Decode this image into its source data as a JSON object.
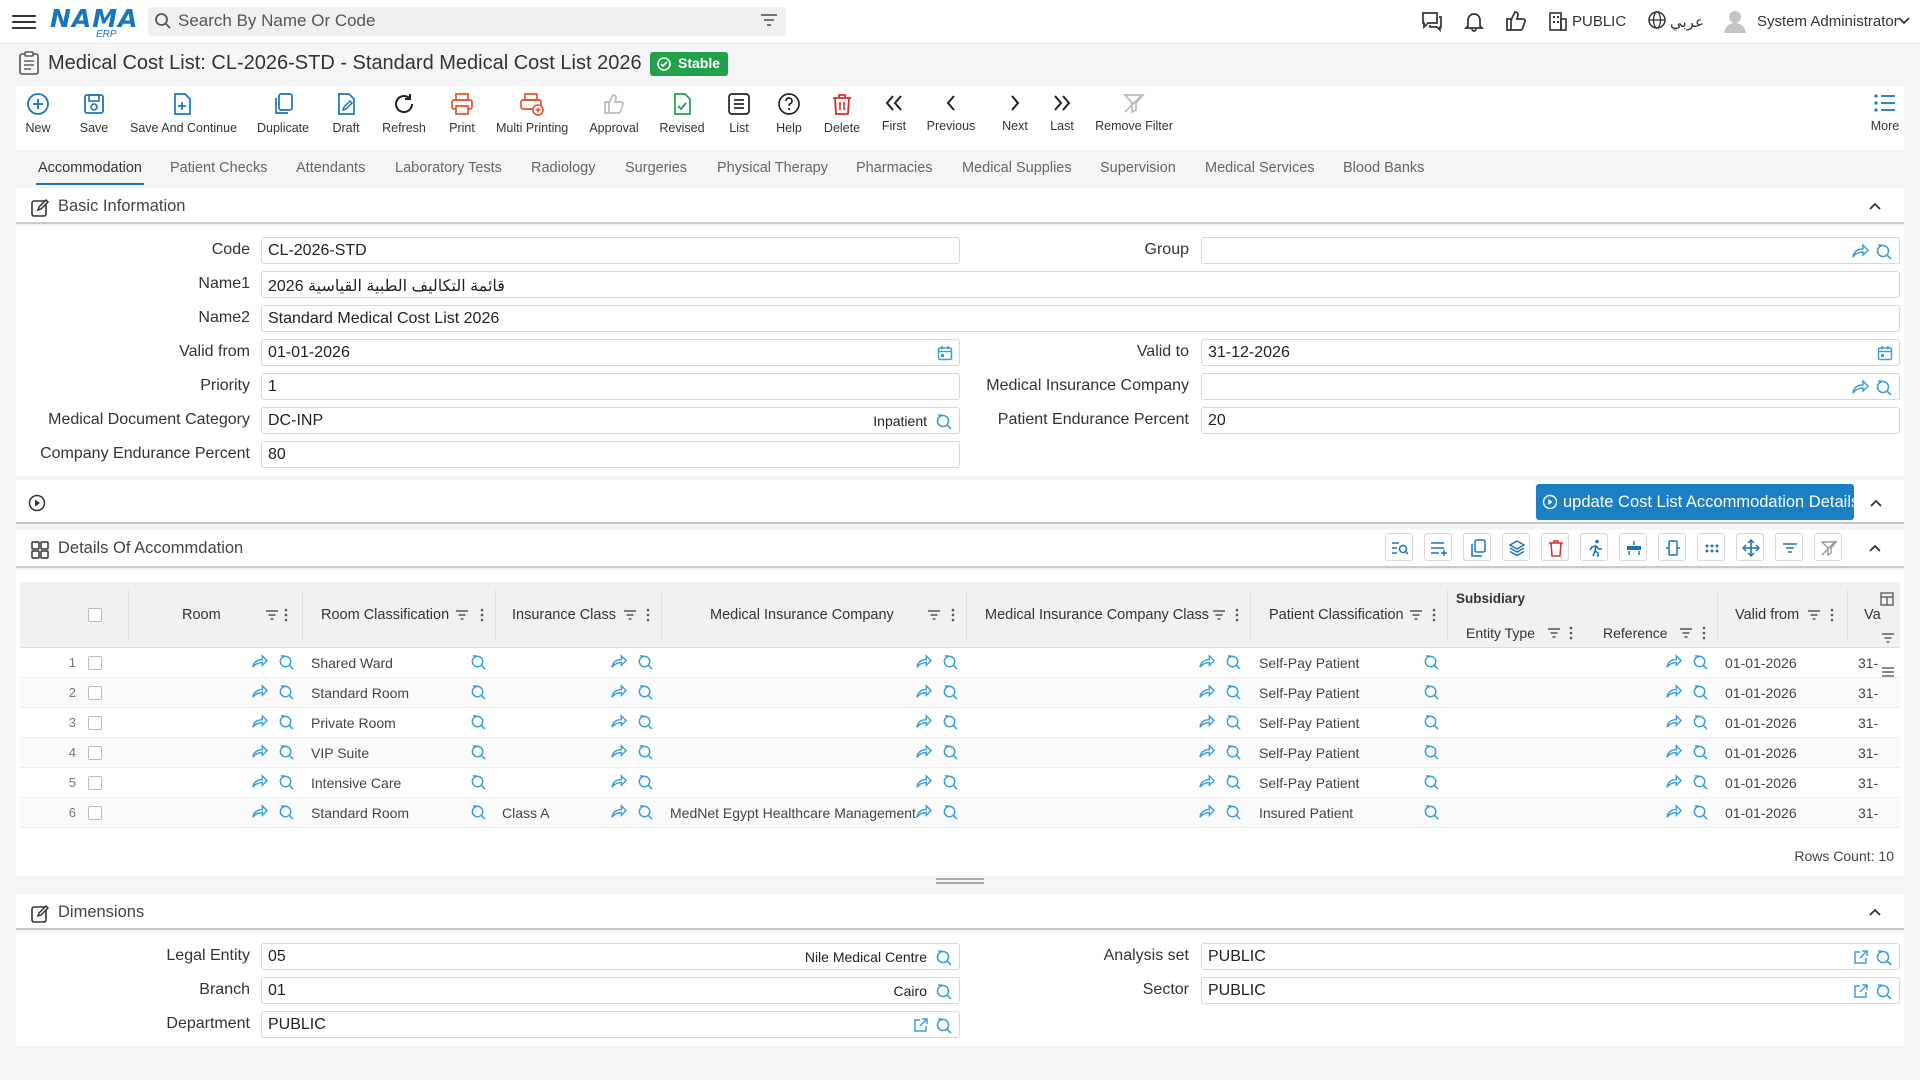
{
  "app": {
    "logo_main": "NAMA",
    "logo_sub": "ERP",
    "search_placeholder": "Search By Name Or Code",
    "public_label": "PUBLIC",
    "language_label": "عربي",
    "user_name": "System Administrator"
  },
  "page": {
    "title": "Medical Cost List: CL-2026-STD - Standard Medical Cost List 2026",
    "status_badge": "Stable"
  },
  "toolbar": {
    "new": "New",
    "save": "Save",
    "save_continue": "Save And Continue",
    "duplicate": "Duplicate",
    "draft": "Draft",
    "refresh": "Refresh",
    "print": "Print",
    "multi_printing": "Multi Printing",
    "approval": "Approval",
    "revised": "Revised",
    "list": "List",
    "help": "Help",
    "delete": "Delete",
    "first": "First",
    "previous": "Previous",
    "next": "Next",
    "last": "Last",
    "remove_filter": "Remove Filter",
    "more": "More"
  },
  "tabs": [
    "Accommodation",
    "Patient Checks",
    "Attendants",
    "Laboratory Tests",
    "Radiology",
    "Surgeries",
    "Physical Therapy",
    "Pharmacies",
    "Medical Supplies",
    "Supervision",
    "Medical Services",
    "Blood Banks"
  ],
  "basic_info": {
    "title": "Basic Information",
    "code_label": "Code",
    "code_value": "CL-2026-STD",
    "group_label": "Group",
    "group_value": "",
    "name1_label": "Name1",
    "name1_value": "قائمة التكاليف الطبية القياسية 2026",
    "name2_label": "Name2",
    "name2_value": "Standard Medical Cost List 2026",
    "valid_from_label": "Valid from",
    "valid_from_value": "01-01-2026",
    "valid_to_label": "Valid to",
    "valid_to_value": "31-12-2026",
    "priority_label": "Priority",
    "priority_value": "1",
    "insurance_company_label": "Medical Insurance Company",
    "insurance_company_value": "",
    "doc_category_label": "Medical Document Category",
    "doc_category_value": "DC-INP",
    "doc_category_desc": "Inpatient",
    "patient_endurance_label": "Patient Endurance Percent",
    "patient_endurance_value": "20",
    "company_endurance_label": "Company Endurance Percent",
    "company_endurance_value": "80"
  },
  "update_button": "update Cost List Accommodation Details",
  "details": {
    "title": "Details Of Accommdation",
    "headers": {
      "room": "Room",
      "room_classification": "Room Classification",
      "insurance_class": "Insurance Class",
      "insurance_company": "Medical Insurance Company",
      "insurance_company_class": "Medical Insurance Company Class",
      "patient_classification": "Patient Classification",
      "subsidiary": "Subsidiary",
      "entity_type": "Entity Type",
      "reference": "Reference",
      "valid_from": "Valid from",
      "valid_to_short": "Va"
    },
    "rows": [
      {
        "num": "1",
        "room_classification": "Shared Ward",
        "insurance_class": "",
        "insurance_company": "",
        "patient_classification": "Self-Pay Patient",
        "valid_from": "01-01-2026",
        "valid_to": "31-"
      },
      {
        "num": "2",
        "room_classification": "Standard Room",
        "insurance_class": "",
        "insurance_company": "",
        "patient_classification": "Self-Pay Patient",
        "valid_from": "01-01-2026",
        "valid_to": "31-"
      },
      {
        "num": "3",
        "room_classification": "Private Room",
        "insurance_class": "",
        "insurance_company": "",
        "patient_classification": "Self-Pay Patient",
        "valid_from": "01-01-2026",
        "valid_to": "31-"
      },
      {
        "num": "4",
        "room_classification": "VIP Suite",
        "insurance_class": "",
        "insurance_company": "",
        "patient_classification": "Self-Pay Patient",
        "valid_from": "01-01-2026",
        "valid_to": "31-"
      },
      {
        "num": "5",
        "room_classification": "Intensive Care",
        "insurance_class": "",
        "insurance_company": "",
        "patient_classification": "Self-Pay Patient",
        "valid_from": "01-01-2026",
        "valid_to": "31-"
      },
      {
        "num": "6",
        "room_classification": "Standard Room",
        "insurance_class": "Class A",
        "insurance_company": "MedNet Egypt Healthcare Management",
        "patient_classification": "Insured Patient",
        "valid_from": "01-01-2026",
        "valid_to": "31-"
      }
    ],
    "rows_count_label": "Rows Count: 10"
  },
  "dimensions": {
    "title": "Dimensions",
    "legal_entity_label": "Legal Entity",
    "legal_entity_value": "05",
    "legal_entity_desc": "Nile Medical Centre",
    "analysis_set_label": "Analysis set",
    "analysis_set_value": "PUBLIC",
    "branch_label": "Branch",
    "branch_value": "01",
    "branch_desc": "Cairo",
    "sector_label": "Sector",
    "sector_value": "PUBLIC",
    "department_label": "Department",
    "department_value": "PUBLIC"
  },
  "colors": {
    "brand": "#1b75bb",
    "stable_badge": "#22a14a",
    "print_icon": "#e2542c",
    "delete_icon": "#d93025",
    "revised_icon": "#22a14a",
    "lookup_icon": "#3aa0d8"
  }
}
